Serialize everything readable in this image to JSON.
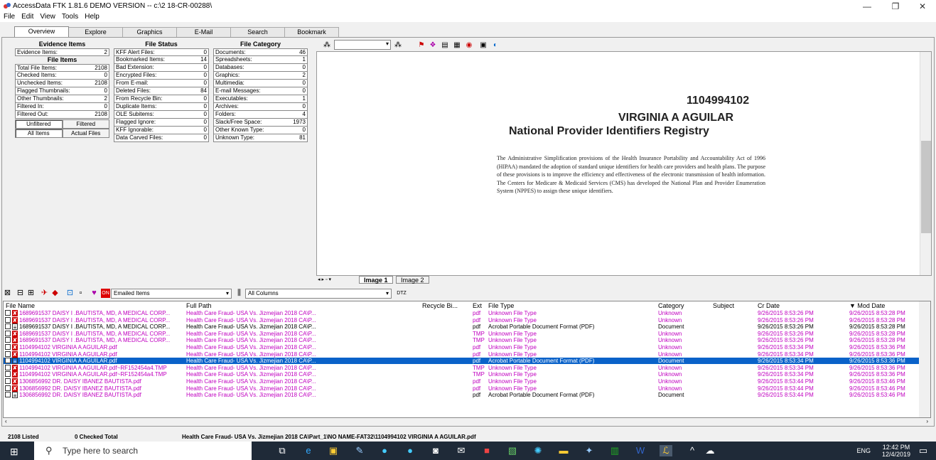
{
  "window": {
    "title": "AccessData FTK 1.81.6 DEMO VERSION -- c:\\2 18-CR-00288\\",
    "minimize": "—",
    "maximize": "❐",
    "close": "✕"
  },
  "menu": [
    "File",
    "Edit",
    "View",
    "Tools",
    "Help"
  ],
  "tabs": [
    "Overview",
    "Explore",
    "Graphics",
    "E-Mail",
    "Search",
    "Bookmark"
  ],
  "evidence_items": {
    "header": "Evidence Items",
    "rows": [
      {
        "label": "Evidence Items:",
        "value": "2"
      }
    ],
    "file_items_header": "File Items",
    "file_rows": [
      {
        "label": "Total File Items:",
        "value": "2108"
      },
      {
        "label": "Checked Items:",
        "value": "0"
      },
      {
        "label": "Unchecked Items:",
        "value": "2108"
      },
      {
        "label": "Flagged Thumbnails:",
        "value": "0"
      },
      {
        "label": "Other Thumbnails:",
        "value": "2"
      },
      {
        "label": "Filtered In:",
        "value": "0"
      },
      {
        "label": "Filtered Out:",
        "value": "2108"
      }
    ],
    "buttons_row1": [
      "Unfiltered",
      "Filtered"
    ],
    "buttons_row2": [
      "All Items",
      "Actual Files"
    ]
  },
  "file_status": {
    "header": "File Status",
    "rows": [
      {
        "label": "KFF Alert Files:",
        "value": "0"
      },
      {
        "label": "Bookmarked Items:",
        "value": "14"
      },
      {
        "label": "Bad Extension:",
        "value": "0"
      },
      {
        "label": "Encrypted Files:",
        "value": "0"
      },
      {
        "label": "From E-mail:",
        "value": "0"
      },
      {
        "label": "Deleted Files:",
        "value": "84"
      },
      {
        "label": "From Recycle Bin:",
        "value": "0"
      },
      {
        "label": "Duplicate Items:",
        "value": "0"
      },
      {
        "label": "OLE Subitems:",
        "value": "0"
      },
      {
        "label": "Flagged Ignore:",
        "value": "0"
      },
      {
        "label": "KFF Ignorable:",
        "value": "0"
      },
      {
        "label": "Data Carved Files:",
        "value": "0"
      }
    ]
  },
  "file_category": {
    "header": "File Category",
    "rows": [
      {
        "label": "Documents:",
        "value": "46"
      },
      {
        "label": "Spreadsheets:",
        "value": "1"
      },
      {
        "label": "Databases:",
        "value": "0"
      },
      {
        "label": "Graphics:",
        "value": "2"
      },
      {
        "label": "Multimedia:",
        "value": "0"
      },
      {
        "label": "E-mail Messages:",
        "value": "0"
      },
      {
        "label": "Executables:",
        "value": "1"
      },
      {
        "label": "Archives:",
        "value": "0"
      },
      {
        "label": "Folders:",
        "value": "4"
      },
      {
        "label": "Slack/Free Space:",
        "value": "1973"
      },
      {
        "label": "Other Known Type:",
        "value": "0"
      },
      {
        "label": "Unknown Type:",
        "value": "81"
      }
    ]
  },
  "viewer": {
    "npi": "1104994102",
    "name": "VIRGINIA A AGUILAR",
    "registry": "National Provider Identifiers Registry",
    "body": "The Administrative Simplification provisions of the Health Insurance Portability and Accountability Act of 1996 (HIPAA) mandated the adoption of standard unique identifiers for health care providers and health plans. The purpose of these provisions is to improve the efficiency and effectiveness of the electronic transmission of health information. The Centers for Medicare & Medicaid Services (CMS) has developed the National Plan and Provider Enumeration System (NPPES) to assign these unique identifiers.",
    "image_tabs": [
      "Image 1",
      "Image 2"
    ]
  },
  "list_toolbar": {
    "filter": "Emailed Items",
    "columns": "All Columns",
    "dtz": "DTZ"
  },
  "grid": {
    "columns": [
      "File Name",
      "Full Path",
      "Recycle Bi...",
      "Ext",
      "File Type",
      "Category",
      "Subject",
      "Cr Date",
      "Mod Date"
    ],
    "rows": [
      {
        "name": "1689691537 DAISY I .BAUTISTA, MD, A MEDICAL CORP...",
        "path": "Health Care Fraud- USA Vs. Jizmejian 2018 CA\\P...",
        "ext": "pdf",
        "type": "Unknown File Type",
        "cat": "Unknown",
        "cr": "9/26/2015 8:53:26 PM",
        "mod": "9/26/2015 8:53:28 PM",
        "color": "#c000c0",
        "icon": "pdfx"
      },
      {
        "name": "1689691537 DAISY I .BAUTISTA, MD, A MEDICAL CORP...",
        "path": "Health Care Fraud- USA Vs. Jizmejian 2018 CA\\P...",
        "ext": "pdf",
        "type": "Unknown File Type",
        "cat": "Unknown",
        "cr": "9/26/2015 8:53:26 PM",
        "mod": "9/26/2015 8:53:28 PM",
        "color": "#c000c0",
        "icon": "pdfx"
      },
      {
        "name": "1689691537 DAISY I .BAUTISTA, MD, A MEDICAL CORP...",
        "path": "Health Care Fraud- USA Vs. Jizmejian 2018 CA\\P...",
        "ext": "pdf",
        "type": "Acrobat Portable Document Format (PDF)",
        "cat": "Document",
        "cr": "9/26/2015 8:53:26 PM",
        "mod": "9/26/2015 8:53:28 PM",
        "color": "#000000",
        "icon": "doc"
      },
      {
        "name": "1689691537 DAISY I .BAUTISTA, MD, A MEDICAL CORP...",
        "path": "Health Care Fraud- USA Vs. Jizmejian 2018 CA\\P...",
        "ext": "TMP",
        "type": "Unknown File Type",
        "cat": "Unknown",
        "cr": "9/26/2015 8:53:26 PM",
        "mod": "9/26/2015 8:53:28 PM",
        "color": "#c000c0",
        "icon": "pdfx"
      },
      {
        "name": "1689691537 DAISY I .BAUTISTA, MD, A MEDICAL CORP...",
        "path": "Health Care Fraud- USA Vs. Jizmejian 2018 CA\\P...",
        "ext": "TMP",
        "type": "Unknown File Type",
        "cat": "Unknown",
        "cr": "9/26/2015 8:53:26 PM",
        "mod": "9/26/2015 8:53:28 PM",
        "color": "#c000c0",
        "icon": "pdfx"
      },
      {
        "name": "1104994102 VIRGINIA A AGUILAR.pdf",
        "path": "Health Care Fraud- USA Vs. Jizmejian 2018 CA\\P...",
        "ext": "pdf",
        "type": "Unknown File Type",
        "cat": "Unknown",
        "cr": "9/26/2015 8:53:34 PM",
        "mod": "9/26/2015 8:53:36 PM",
        "color": "#c000c0",
        "icon": "pdfx"
      },
      {
        "name": "1104994102 VIRGINIA A AGUILAR.pdf",
        "path": "Health Care Fraud- USA Vs. Jizmejian 2018 CA\\P...",
        "ext": "pdf",
        "type": "Unknown File Type",
        "cat": "Unknown",
        "cr": "9/26/2015 8:53:34 PM",
        "mod": "9/26/2015 8:53:36 PM",
        "color": "#c000c0",
        "icon": "pdfx"
      },
      {
        "name": "1104994102 VIRGINIA A AGUILAR.pdf",
        "path": "Health Care Fraud- USA Vs. Jizmejian 2018 CA\\P...",
        "ext": "pdf",
        "type": "Acrobat Portable Document Format (PDF)",
        "cat": "Document",
        "cr": "9/26/2015 8:53:34 PM",
        "mod": "9/26/2015 8:53:36 PM",
        "color": "#000000",
        "icon": "doc",
        "selected": true
      },
      {
        "name": "1104994102 VIRGINIA A AGUILAR.pdf~RF152454a4.TMP",
        "path": "Health Care Fraud- USA Vs. Jizmejian 2018 CA\\P...",
        "ext": "TMP",
        "type": "Unknown File Type",
        "cat": "Unknown",
        "cr": "9/26/2015 8:53:34 PM",
        "mod": "9/26/2015 8:53:36 PM",
        "color": "#c000c0",
        "icon": "pdfx"
      },
      {
        "name": "1104994102 VIRGINIA A AGUILAR.pdf~RF152454a4.TMP",
        "path": "Health Care Fraud- USA Vs. Jizmejian 2018 CA\\P...",
        "ext": "TMP",
        "type": "Unknown File Type",
        "cat": "Unknown",
        "cr": "9/26/2015 8:53:34 PM",
        "mod": "9/26/2015 8:53:36 PM",
        "color": "#c000c0",
        "icon": "pdfx"
      },
      {
        "name": "1306856992 DR. DAISY IBANEZ BAUTISTA.pdf",
        "path": "Health Care Fraud- USA Vs. Jizmejian 2018 CA\\P...",
        "ext": "pdf",
        "type": "Unknown File Type",
        "cat": "Unknown",
        "cr": "9/26/2015 8:53:44 PM",
        "mod": "9/26/2015 8:53:46 PM",
        "color": "#c000c0",
        "icon": "pdfx"
      },
      {
        "name": "1306856992 DR. DAISY IBANEZ BAUTISTA.pdf",
        "path": "Health Care Fraud- USA Vs. Jizmejian 2018 CA\\P...",
        "ext": "pdf",
        "type": "Unknown File Type",
        "cat": "Unknown",
        "cr": "9/26/2015 8:53:44 PM",
        "mod": "9/26/2015 8:53:46 PM",
        "color": "#c000c0",
        "icon": "pdfx"
      },
      {
        "name": "1306856992 DR. DAISY IBANEZ BAUTISTA.pdf",
        "path": "Health Care Fraud- USA Vs. Jizmejian 2018 CA\\P...",
        "ext": "pdf",
        "type": "Acrobat Portable Document Format (PDF)",
        "cat": "Document",
        "cr": "9/26/2015 8:53:44 PM",
        "mod": "9/26/2015 8:53:46 PM",
        "color": "#000000",
        "icon": "doc",
        "magenta_name": true
      }
    ]
  },
  "status": {
    "listed": "2108 Listed",
    "checked": "0 Checked Total",
    "path": "Health Care Fraud- USA Vs. Jizmejian 2018 CA\\Part_1\\NO NAME-FAT32\\1104994102 VIRGINIA A AGUILAR.pdf"
  },
  "taskbar": {
    "search_placeholder": "Type here to search",
    "lang": "ENG",
    "time": "12:42 PM",
    "date": "12/4/2019"
  }
}
